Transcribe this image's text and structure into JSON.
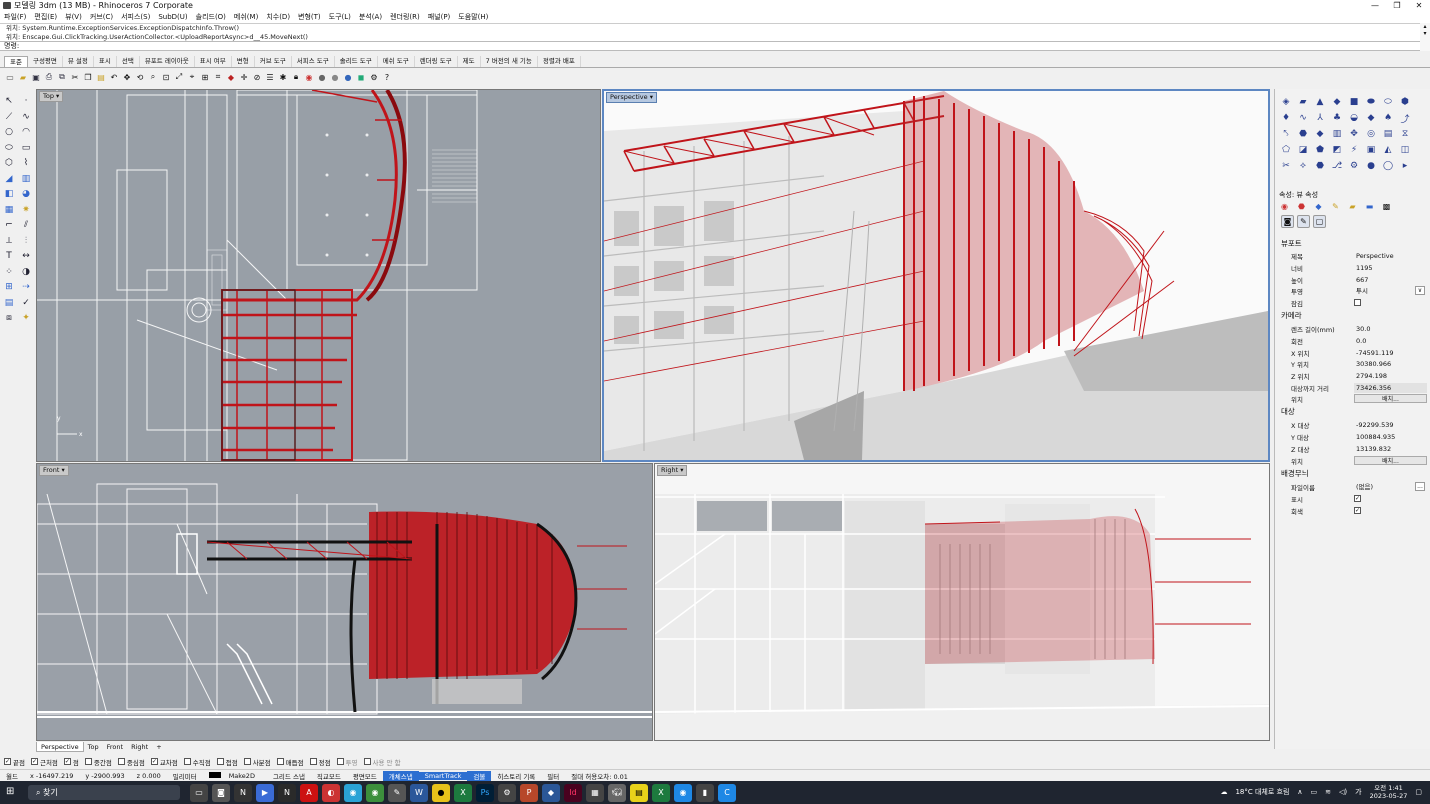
{
  "titlebar": {
    "title": "모델링 3dm (13 MB) - Rhinoceros 7 Corporate",
    "minimize_label": "—",
    "maximize_label": "❐",
    "close_label": "✕"
  },
  "menu": [
    "파일(F)",
    "편집(E)",
    "뷰(V)",
    "커브(C)",
    "서피스(S)",
    "SubD(U)",
    "솔리드(O)",
    "메쉬(M)",
    "치수(D)",
    "변형(T)",
    "도구(L)",
    "분석(A)",
    "렌더링(R)",
    "패널(P)",
    "도움말(H)"
  ],
  "command_history": {
    "line1": "위치: System.Runtime.ExceptionServices.ExceptionDispatchInfo.Throw()",
    "line2": "위치: Enscape.Gui.ClickTracking.UserActionCollector.<UploadReportAsync>d__45.MoveNext()"
  },
  "command_prompt": "명령:",
  "toolbar_tabs": [
    "표준",
    "구성평면",
    "뷰 설정",
    "표시",
    "선택",
    "뷰포트 레이아웃",
    "표시 여부",
    "변형",
    "커브 도구",
    "서피스 도구",
    "솔리드 도구",
    "메쉬 도구",
    "렌더링 도구",
    "제도",
    "7 버전의 새 기능",
    "정렬과 배포"
  ],
  "active_tab_index": 0,
  "viewports": {
    "top": "Top",
    "perspective": "Perspective",
    "front": "Front",
    "right": "Right"
  },
  "viewport_tabs": [
    "Perspective",
    "Top",
    "Front",
    "Right"
  ],
  "viewport_tab_add": "+",
  "osnaps": [
    {
      "label": "끝점",
      "checked": true
    },
    {
      "label": "근처점",
      "checked": true
    },
    {
      "label": "점",
      "checked": true
    },
    {
      "label": "중간점",
      "checked": false
    },
    {
      "label": "중심점",
      "checked": false
    },
    {
      "label": "교차점",
      "checked": true
    },
    {
      "label": "수직점",
      "checked": false
    },
    {
      "label": "접점",
      "checked": false
    },
    {
      "label": "사분점",
      "checked": false
    },
    {
      "label": "매듭점",
      "checked": false
    },
    {
      "label": "정점",
      "checked": false
    },
    {
      "label": "투영",
      "checked": false
    },
    {
      "label": "사용 안 함",
      "checked": false
    }
  ],
  "statusbar": {
    "cplane": "월드",
    "x": "x -16497.219",
    "y": "y -2900.993",
    "z": "z 0.000",
    "units": "밀리미터",
    "layer": "Make2D",
    "grid_snap": "그리드 스냅",
    "ortho": "직교모드",
    "planar": "평면모드",
    "osnap": "개체스냅",
    "smarttrack": "SmartTrack",
    "gumball": "검볼",
    "history": "히스토리 기록",
    "filter": "필터",
    "tolerance": "절대 허용오차: 0.01"
  },
  "properties": {
    "panel_title": "속성: 뷰 속성",
    "section_viewport": "뷰포트",
    "title_label": "제목",
    "title_value": "Perspective",
    "width_label": "너비",
    "width_value": "1195",
    "height_label": "높이",
    "height_value": "667",
    "projection_label": "투영",
    "projection_value": "투시",
    "locked_label": "잠김",
    "section_camera": "카메라",
    "lens_label": "렌즈 길이(mm)",
    "lens_value": "30.0",
    "rotation_label": "회전",
    "rotation_value": "0.0",
    "xpos_label": "X 위치",
    "xpos_value": "-74591.119",
    "ypos_label": "Y 위치",
    "ypos_value": "30380.966",
    "zpos_label": "Z 위치",
    "zpos_value": "2794.198",
    "dist_label": "대상까지 거리",
    "dist_value": "73426.356",
    "loc_label": "위치",
    "place_button": "배치...",
    "section_target": "대상",
    "xtgt_label": "X 대상",
    "xtgt_value": "-92299.539",
    "ytgt_label": "Y 대상",
    "ytgt_value": "100884.935",
    "ztgt_label": "Z 대상",
    "ztgt_value": "13139.832",
    "tloc_label": "위치",
    "tplace_button": "배치...",
    "section_bg": "배경무늬",
    "file_label": "파일이름",
    "file_value": "(없음)",
    "file_button": "...",
    "show_label": "표시",
    "gray_label": "회색"
  },
  "taskbar": {
    "search_placeholder": "찾기",
    "weather": "18°C 대체로 흐림",
    "time": "오전 1:41",
    "date": "2023-05-27",
    "lang": "가"
  },
  "colors": {
    "accent": "#2d6fd1",
    "structure_red": "#c0141a",
    "viewport_gray": "#989fa7",
    "taskbar": "#1f2530"
  }
}
